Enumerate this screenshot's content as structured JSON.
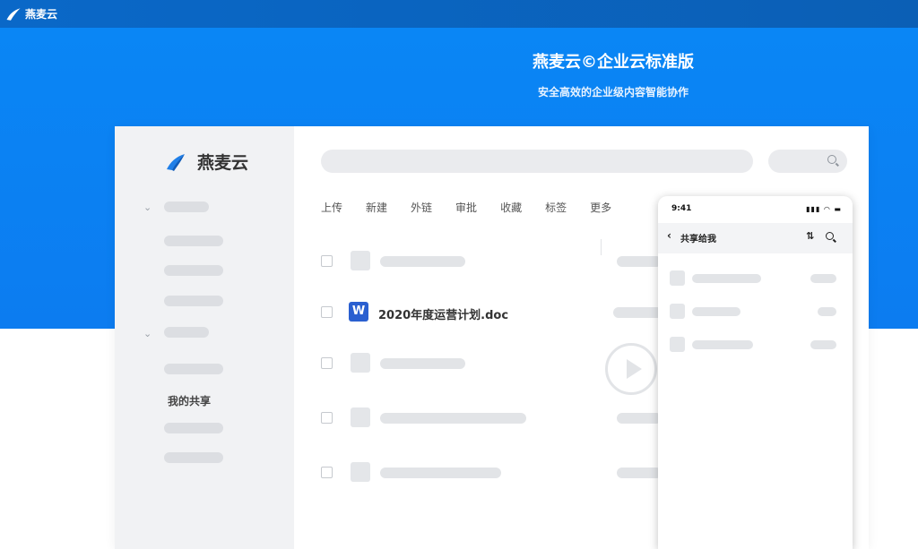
{
  "topbar": {
    "brand": "燕麦云"
  },
  "hero": {
    "title": "燕麦云©企业云标准版",
    "subtitle": "安全高效的企业级内容智能协作"
  },
  "app": {
    "brand": "燕麦云",
    "sidebar": {
      "highlighted_item": "我的共享"
    },
    "toolbar": [
      "上传",
      "新建",
      "外链",
      "审批",
      "收藏",
      "标签",
      "更多"
    ],
    "file": {
      "icon_letter": "W",
      "name": "2020年度运营计划.doc"
    }
  },
  "phone": {
    "time": "9:41",
    "title": "共享给我"
  },
  "colors": {
    "brand": "#0c7cf0",
    "topbar": "#0a68c8",
    "word_icon": "#2a5fd0"
  }
}
